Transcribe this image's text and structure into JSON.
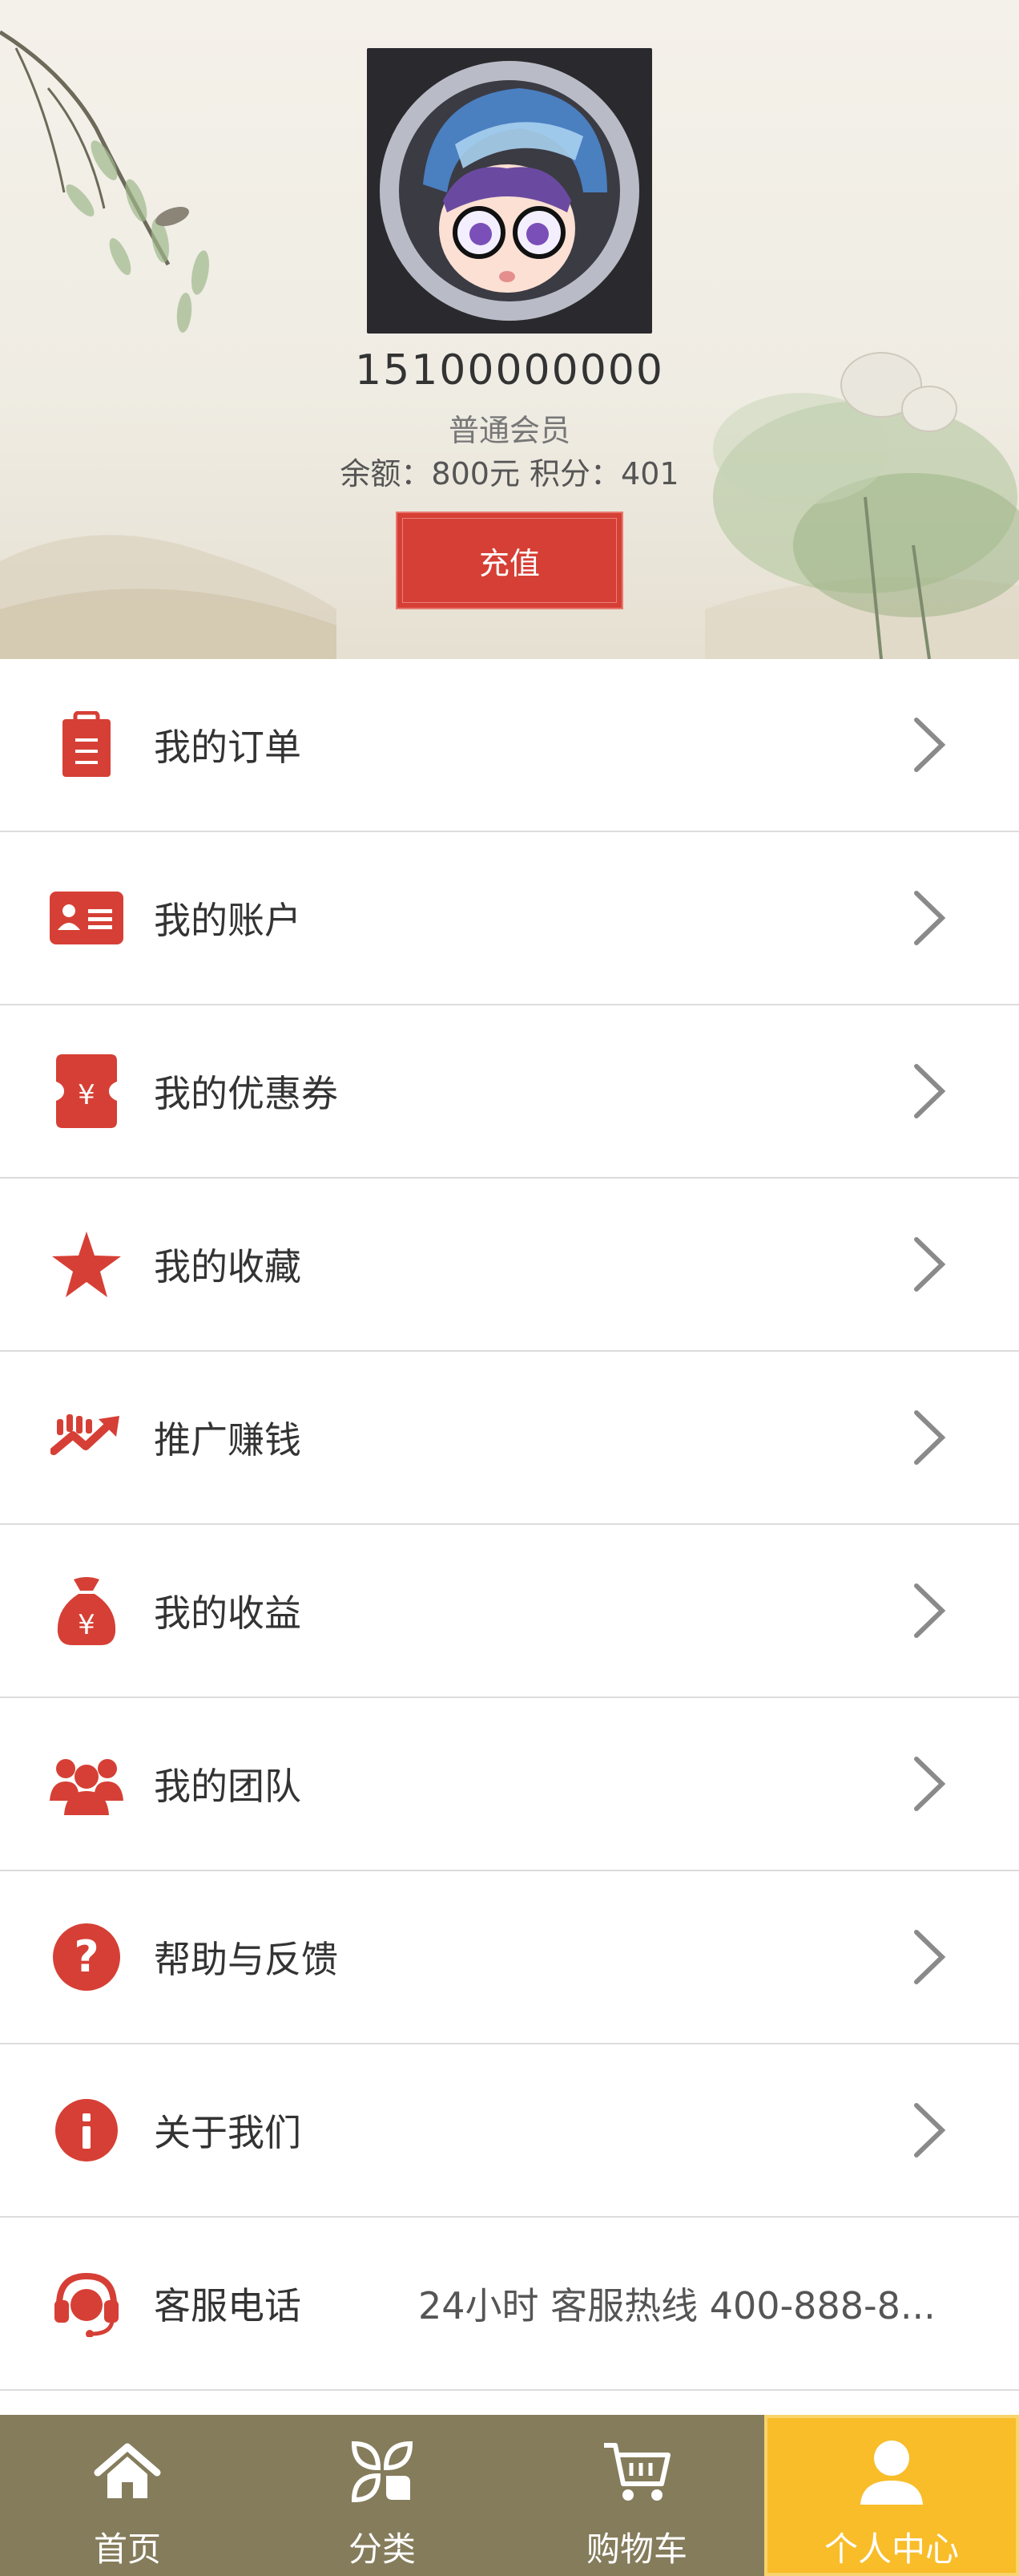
{
  "profile": {
    "phone": "15100000000",
    "level": "普通会员",
    "balance": "余额：800元 积分：401",
    "recharge_label": "充值"
  },
  "menu": [
    {
      "label": "我的订单",
      "icon": "clipboard-icon"
    },
    {
      "label": "我的账户",
      "icon": "id-card-icon"
    },
    {
      "label": "我的优惠券",
      "icon": "coupon-icon"
    },
    {
      "label": "我的收藏",
      "icon": "star-icon"
    },
    {
      "label": "推广赚钱",
      "icon": "trend-icon"
    },
    {
      "label": "我的收益",
      "icon": "money-bag-icon"
    },
    {
      "label": "我的团队",
      "icon": "team-icon"
    },
    {
      "label": "帮助与反馈",
      "icon": "help-icon"
    },
    {
      "label": "关于我们",
      "icon": "info-icon"
    },
    {
      "label": "客服电话",
      "icon": "headset-icon",
      "value": "24小时 客服热线 400-888-8..."
    }
  ],
  "tabbar": [
    {
      "label": "首页",
      "icon": "home-icon"
    },
    {
      "label": "分类",
      "icon": "category-icon"
    },
    {
      "label": "购物车",
      "icon": "cart-icon"
    },
    {
      "label": "个人中心",
      "icon": "user-icon",
      "active": true
    }
  ],
  "colors": {
    "accent": "#d63f35",
    "tabbar_bg": "#857c5c",
    "tab_active": "#f8bd29"
  }
}
